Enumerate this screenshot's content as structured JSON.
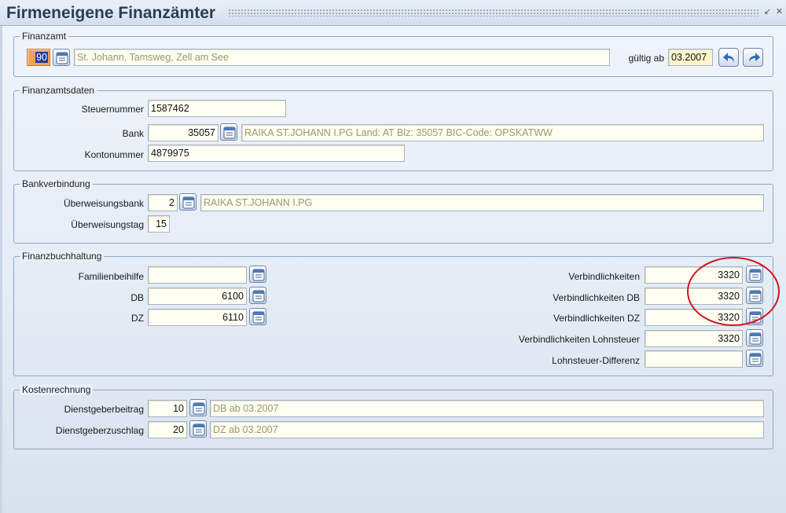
{
  "window": {
    "title": "Firmeneigene Finanzämter"
  },
  "finanzamt": {
    "legend": "Finanzamt",
    "code": "90",
    "name": "St. Johann, Tamsweg, Zell am See",
    "gueltig_label": "gültig ab",
    "gueltig_value": "03.2007"
  },
  "finanzamtsdaten": {
    "legend": "Finanzamtsdaten",
    "steuernummer_label": "Steuernummer",
    "steuernummer": "1587462",
    "bank_label": "Bank",
    "bank_code": "35057",
    "bank_desc": "RAIKA ST.JOHANN I.PG Land: AT Blz: 35057 BIC-Code: OPSKATWW",
    "kontonummer_label": "Kontonummer",
    "kontonummer": "4879975"
  },
  "bankverbindung": {
    "legend": "Bankverbindung",
    "bank_label": "Überweisungsbank",
    "bank_code": "2",
    "bank_desc": "RAIKA ST.JOHANN I.PG",
    "tag_label": "Überweisungstag",
    "tag_value": "15"
  },
  "finanzbuchhaltung": {
    "legend": "Finanzbuchhaltung",
    "left": [
      {
        "label": "Familienbeihilfe",
        "value": ""
      },
      {
        "label": "DB",
        "value": "6100"
      },
      {
        "label": "DZ",
        "value": "6110"
      }
    ],
    "right": [
      {
        "label": "Verbindlichkeiten",
        "value": "3320"
      },
      {
        "label": "Verbindlichkeiten DB",
        "value": "3320"
      },
      {
        "label": "Verbindlichkeiten DZ",
        "value": "3320"
      },
      {
        "label": "Verbindlichkeiten Lohnsteuer",
        "value": "3320"
      },
      {
        "label": "Lohnsteuer-Differenz",
        "value": ""
      }
    ]
  },
  "kostenrechnung": {
    "legend": "Kostenrechnung",
    "rows": [
      {
        "label": "Dienstgeberbeitrag",
        "value": "10",
        "desc": "DB ab 03.2007"
      },
      {
        "label": "Dienstgeberzuschlag",
        "value": "20",
        "desc": "DZ ab 03.2007"
      }
    ]
  },
  "icons": {
    "lov": "list-of-values-icon",
    "back": "back-arrow-icon",
    "forward": "forward-arrow-icon",
    "minimize": "minimize-icon",
    "close": "close-icon"
  },
  "colors": {
    "frame_border": "#8ea6c6",
    "field_bg": "#fefef2",
    "readonly_text": "#9a9a6a",
    "selected_bg": "#f2a15a",
    "annotation": "#d4121a"
  }
}
